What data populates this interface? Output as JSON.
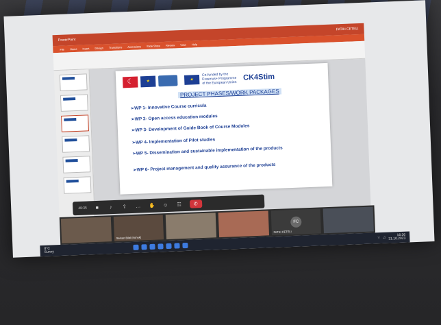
{
  "window": {
    "title": "PowerPoint",
    "user": "FATIH CETELI"
  },
  "ribbon": {
    "tabs": [
      "File",
      "Home",
      "Insert",
      "Design",
      "Transitions",
      "Animations",
      "Slide Show",
      "Review",
      "View",
      "Help"
    ]
  },
  "slide": {
    "cofund_text": "Co-funded by the Erasmus+ Programme of the European Union",
    "brand": "CK4Stim",
    "heading": "PROJECT PHASES/WORK PACKAGES",
    "items": [
      "➢WP 1- Innovative Course curricula",
      "➢WP 2- Open access education modules",
      "➢WP 3- Development of Guide Book of Course Modules",
      "➢WP 4- Implementation of Pilot studies",
      "➢WP 5- Dissemination and sustainable implementation of the products",
      "➢WP 6- Project management and quality assurance of the products"
    ]
  },
  "meeting": {
    "elapsed": "48:35",
    "end_label": "✆"
  },
  "participants": [
    {
      "name": ""
    },
    {
      "name": "Serkan Bilal (Konuk)"
    },
    {
      "name": ""
    },
    {
      "name": ""
    },
    {
      "name": "FATIH CETELI",
      "initials": "FC"
    },
    {
      "name": ""
    }
  ],
  "taskbar": {
    "temp": "8°C",
    "cond": "Sunny",
    "time": "16:36",
    "date": "31.10.2023"
  },
  "colors": {
    "accent": "#c4452a",
    "brand_blue": "#1d3f94"
  }
}
